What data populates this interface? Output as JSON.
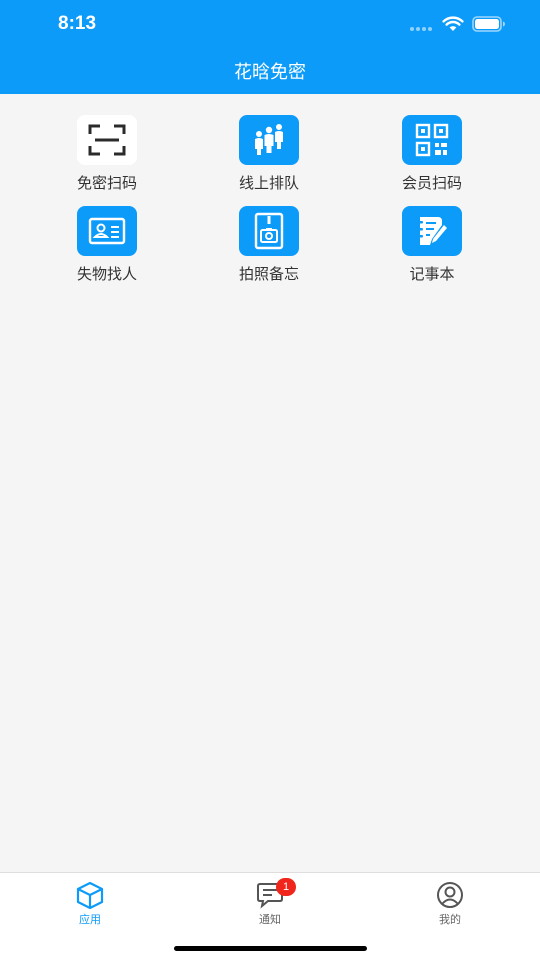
{
  "status_bar": {
    "time": "8:13"
  },
  "header": {
    "title": "花晗免密"
  },
  "apps": [
    {
      "label": "免密扫码",
      "icon": "scan-icon"
    },
    {
      "label": "线上排队",
      "icon": "people-queue-icon"
    },
    {
      "label": "会员扫码",
      "icon": "qr-code-icon"
    },
    {
      "label": "失物找人",
      "icon": "id-card-icon"
    },
    {
      "label": "拍照备忘",
      "icon": "camera-photo-icon"
    },
    {
      "label": "记事本",
      "icon": "notebook-edit-icon"
    }
  ],
  "tab_bar": {
    "tabs": [
      {
        "label": "应用",
        "icon": "cube-icon",
        "active": true
      },
      {
        "label": "通知",
        "icon": "message-icon",
        "badge": "1"
      },
      {
        "label": "我的",
        "icon": "user-icon"
      }
    ]
  },
  "colors": {
    "primary": "#0d9bfa",
    "badge": "#f0261c",
    "background": "#f5f5f5"
  }
}
